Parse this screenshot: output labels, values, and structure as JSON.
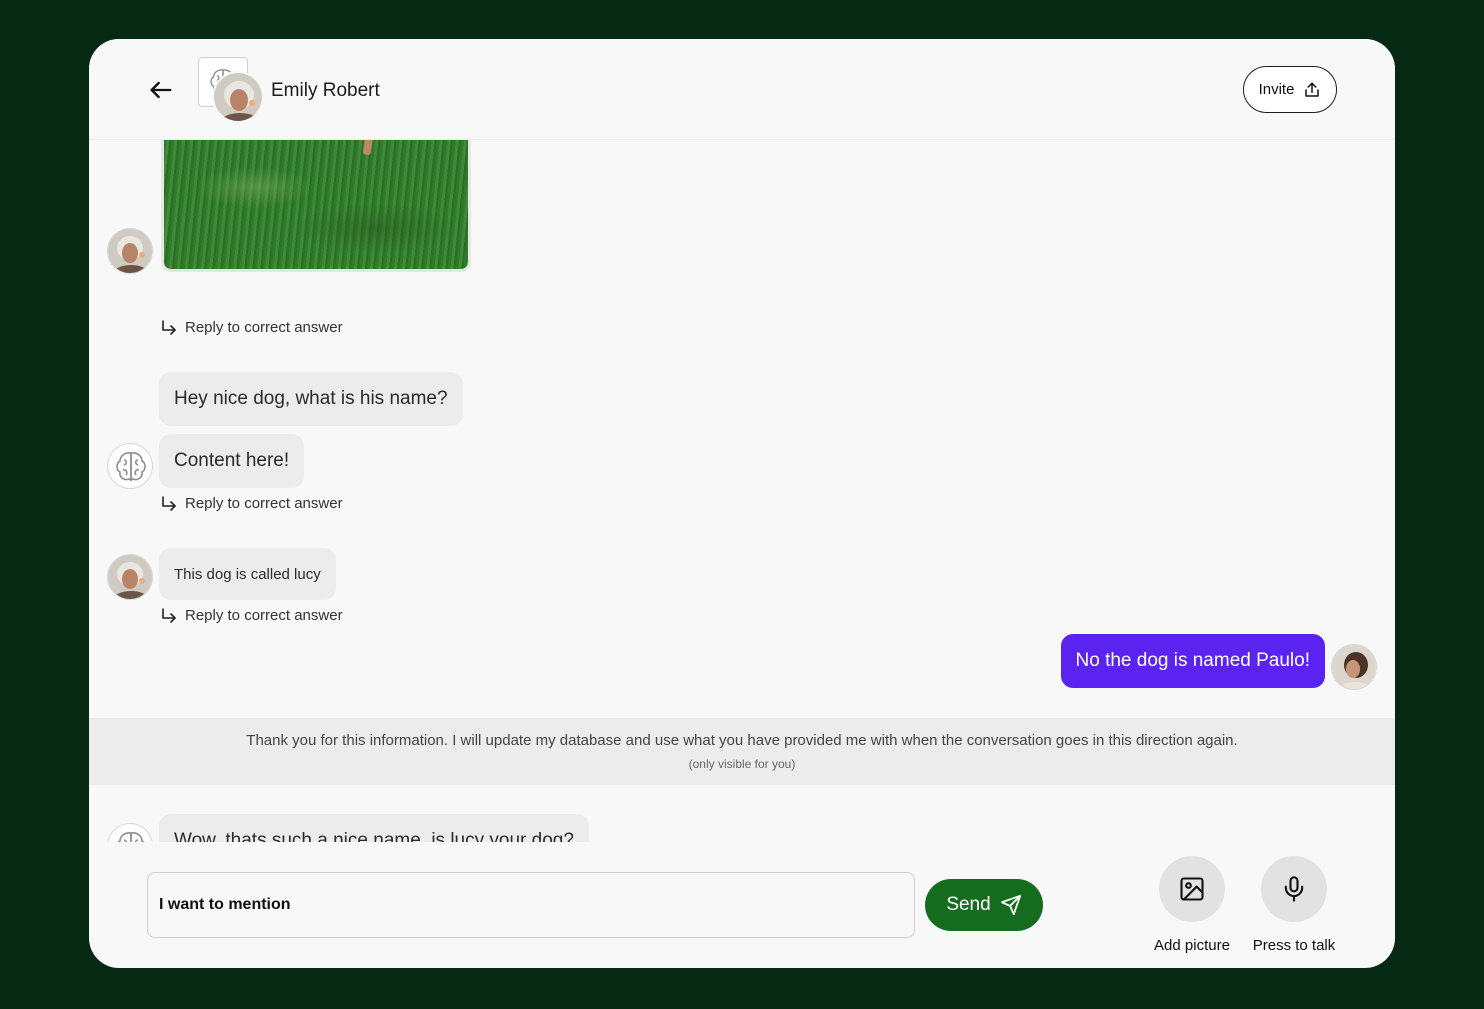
{
  "header": {
    "name": "Emily Robert",
    "invite_label": "Invite"
  },
  "messages": {
    "reply_label": "Reply to correct answer",
    "m1": "Hey nice dog, what is his name?",
    "m2": "Content here!",
    "m3": "This dog is called lucy",
    "m4": "No the dog is named Paulo!",
    "m5": "Wow, thats such a nice name. is lucy your dog?"
  },
  "system_note": {
    "text": "Thank you for this information. I will update my database and use what you have provided me with when the conversation goes in this direction again.",
    "visibility": "(only visible for you)"
  },
  "composer": {
    "value": "I want to mention",
    "send_label": "Send",
    "add_picture_label": "Add picture",
    "press_to_talk_label": "Press to talk"
  },
  "colors": {
    "background": "#062914",
    "accent_purple": "#5b23f0",
    "send_green": "#166c1e"
  },
  "icons": [
    "arrow-left-icon",
    "brain-icon",
    "share-icon",
    "reply-arrow-icon",
    "send-icon",
    "image-icon",
    "microphone-icon"
  ]
}
